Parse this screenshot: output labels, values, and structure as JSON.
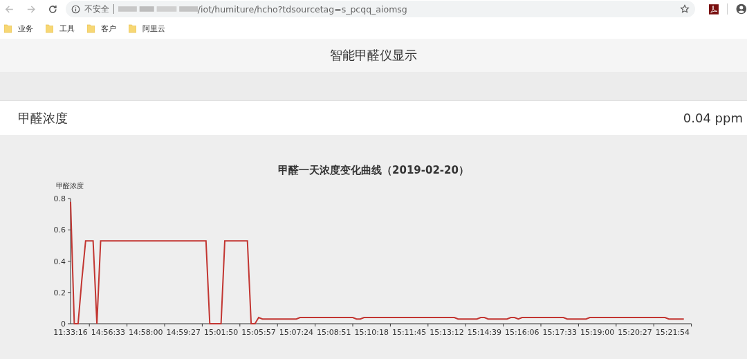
{
  "browser": {
    "security_label": "不安全",
    "url_path": "/iot/humiture/hcho?tdsourcetag=s_pcqq_aiomsg",
    "bookmarks": [
      {
        "label": "业务"
      },
      {
        "label": "工具"
      },
      {
        "label": "客户"
      },
      {
        "label": "阿里云"
      }
    ]
  },
  "header": {
    "title": "智能甲醛仪显示"
  },
  "reading": {
    "label": "甲醛浓度",
    "value": "0.04 ppm"
  },
  "chart": {
    "chart_data": {
      "type": "line",
      "title": "甲醛一天浓度变化曲线（2019-02-20）",
      "ylabel": "甲醛浓度",
      "categories": [
        "11:33:16",
        null,
        null,
        null,
        null,
        null,
        null,
        null,
        null,
        null,
        "14:56:33",
        null,
        null,
        null,
        null,
        null,
        null,
        null,
        null,
        null,
        "14:58:00",
        null,
        null,
        null,
        null,
        null,
        null,
        null,
        null,
        null,
        "14:59:27",
        null,
        null,
        null,
        null,
        null,
        null,
        null,
        null,
        null,
        "15:01:50",
        null,
        null,
        null,
        null,
        null,
        null,
        null,
        null,
        null,
        "15:05:57",
        null,
        null,
        null,
        null,
        null,
        null,
        null,
        null,
        null,
        "15:07:24",
        null,
        null,
        null,
        null,
        null,
        null,
        null,
        null,
        null,
        "15:08:51",
        null,
        null,
        null,
        null,
        null,
        null,
        null,
        null,
        null,
        "15:10:18",
        null,
        null,
        null,
        null,
        null,
        null,
        null,
        null,
        null,
        "15:11:45",
        null,
        null,
        null,
        null,
        null,
        null,
        null,
        null,
        null,
        "15:13:12",
        null,
        null,
        null,
        null,
        null,
        null,
        null,
        null,
        null,
        "15:14:39",
        null,
        null,
        null,
        null,
        null,
        null,
        null,
        null,
        null,
        "15:16:06",
        null,
        null,
        null,
        null,
        null,
        null,
        null,
        null,
        null,
        "15:17:33",
        null,
        null,
        null,
        null,
        null,
        null,
        null,
        null,
        null,
        "15:19:00",
        null,
        null,
        null,
        null,
        null,
        null,
        null,
        null,
        null,
        "15:20:27",
        null,
        null,
        null,
        null,
        null,
        null,
        null,
        null,
        null,
        "15:21:54",
        null,
        null,
        null
      ],
      "series": [
        {
          "color": "#c23531",
          "values": [
            0.78,
            0,
            0,
            0.28,
            0.53,
            0.53,
            0.53,
            0,
            0.53,
            0.53,
            0.53,
            0.53,
            0.53,
            0.53,
            0.53,
            0.53,
            0.53,
            0.53,
            0.53,
            0.53,
            0.53,
            0.53,
            0.53,
            0.53,
            0.53,
            0.53,
            0.53,
            0.53,
            0.53,
            0.53,
            0.53,
            0.53,
            0.53,
            0.53,
            0.53,
            0.53,
            0.53,
            0,
            0,
            0,
            0,
            0.53,
            0.53,
            0.53,
            0.53,
            0.53,
            0.53,
            0.53,
            0,
            0,
            0.04,
            0.03,
            0.03,
            0.03,
            0.03,
            0.03,
            0.03,
            0.03,
            0.03,
            0.03,
            0.03,
            0.04,
            0.04,
            0.04,
            0.04,
            0.04,
            0.04,
            0.04,
            0.04,
            0.04,
            0.04,
            0.04,
            0.04,
            0.04,
            0.04,
            0.04,
            0.03,
            0.03,
            0.04,
            0.04,
            0.04,
            0.04,
            0.04,
            0.04,
            0.04,
            0.04,
            0.04,
            0.04,
            0.04,
            0.04,
            0.04,
            0.04,
            0.04,
            0.04,
            0.04,
            0.04,
            0.04,
            0.04,
            0.04,
            0.04,
            0.04,
            0.04,
            0.04,
            0.03,
            0.03,
            0.03,
            0.03,
            0.03,
            0.03,
            0.04,
            0.04,
            0.03,
            0.03,
            0.03,
            0.03,
            0.03,
            0.03,
            0.04,
            0.04,
            0.03,
            0.04,
            0.04,
            0.04,
            0.04,
            0.04,
            0.04,
            0.04,
            0.04,
            0.04,
            0.04,
            0.04,
            0.04,
            0.03,
            0.03,
            0.03,
            0.03,
            0.03,
            0.03,
            0.04,
            0.04,
            0.04,
            0.04,
            0.04,
            0.04,
            0.04,
            0.04,
            0.04,
            0.04,
            0.04,
            0.04,
            0.04,
            0.04,
            0.04,
            0.04,
            0.04,
            0.04,
            0.04,
            0.04,
            0.04,
            0.03,
            0.03,
            0.03,
            0.03,
            0.03
          ]
        }
      ],
      "ylim": [
        0,
        0.8
      ],
      "yticks": [
        0,
        0.2,
        0.4,
        0.6,
        0.8
      ]
    }
  }
}
